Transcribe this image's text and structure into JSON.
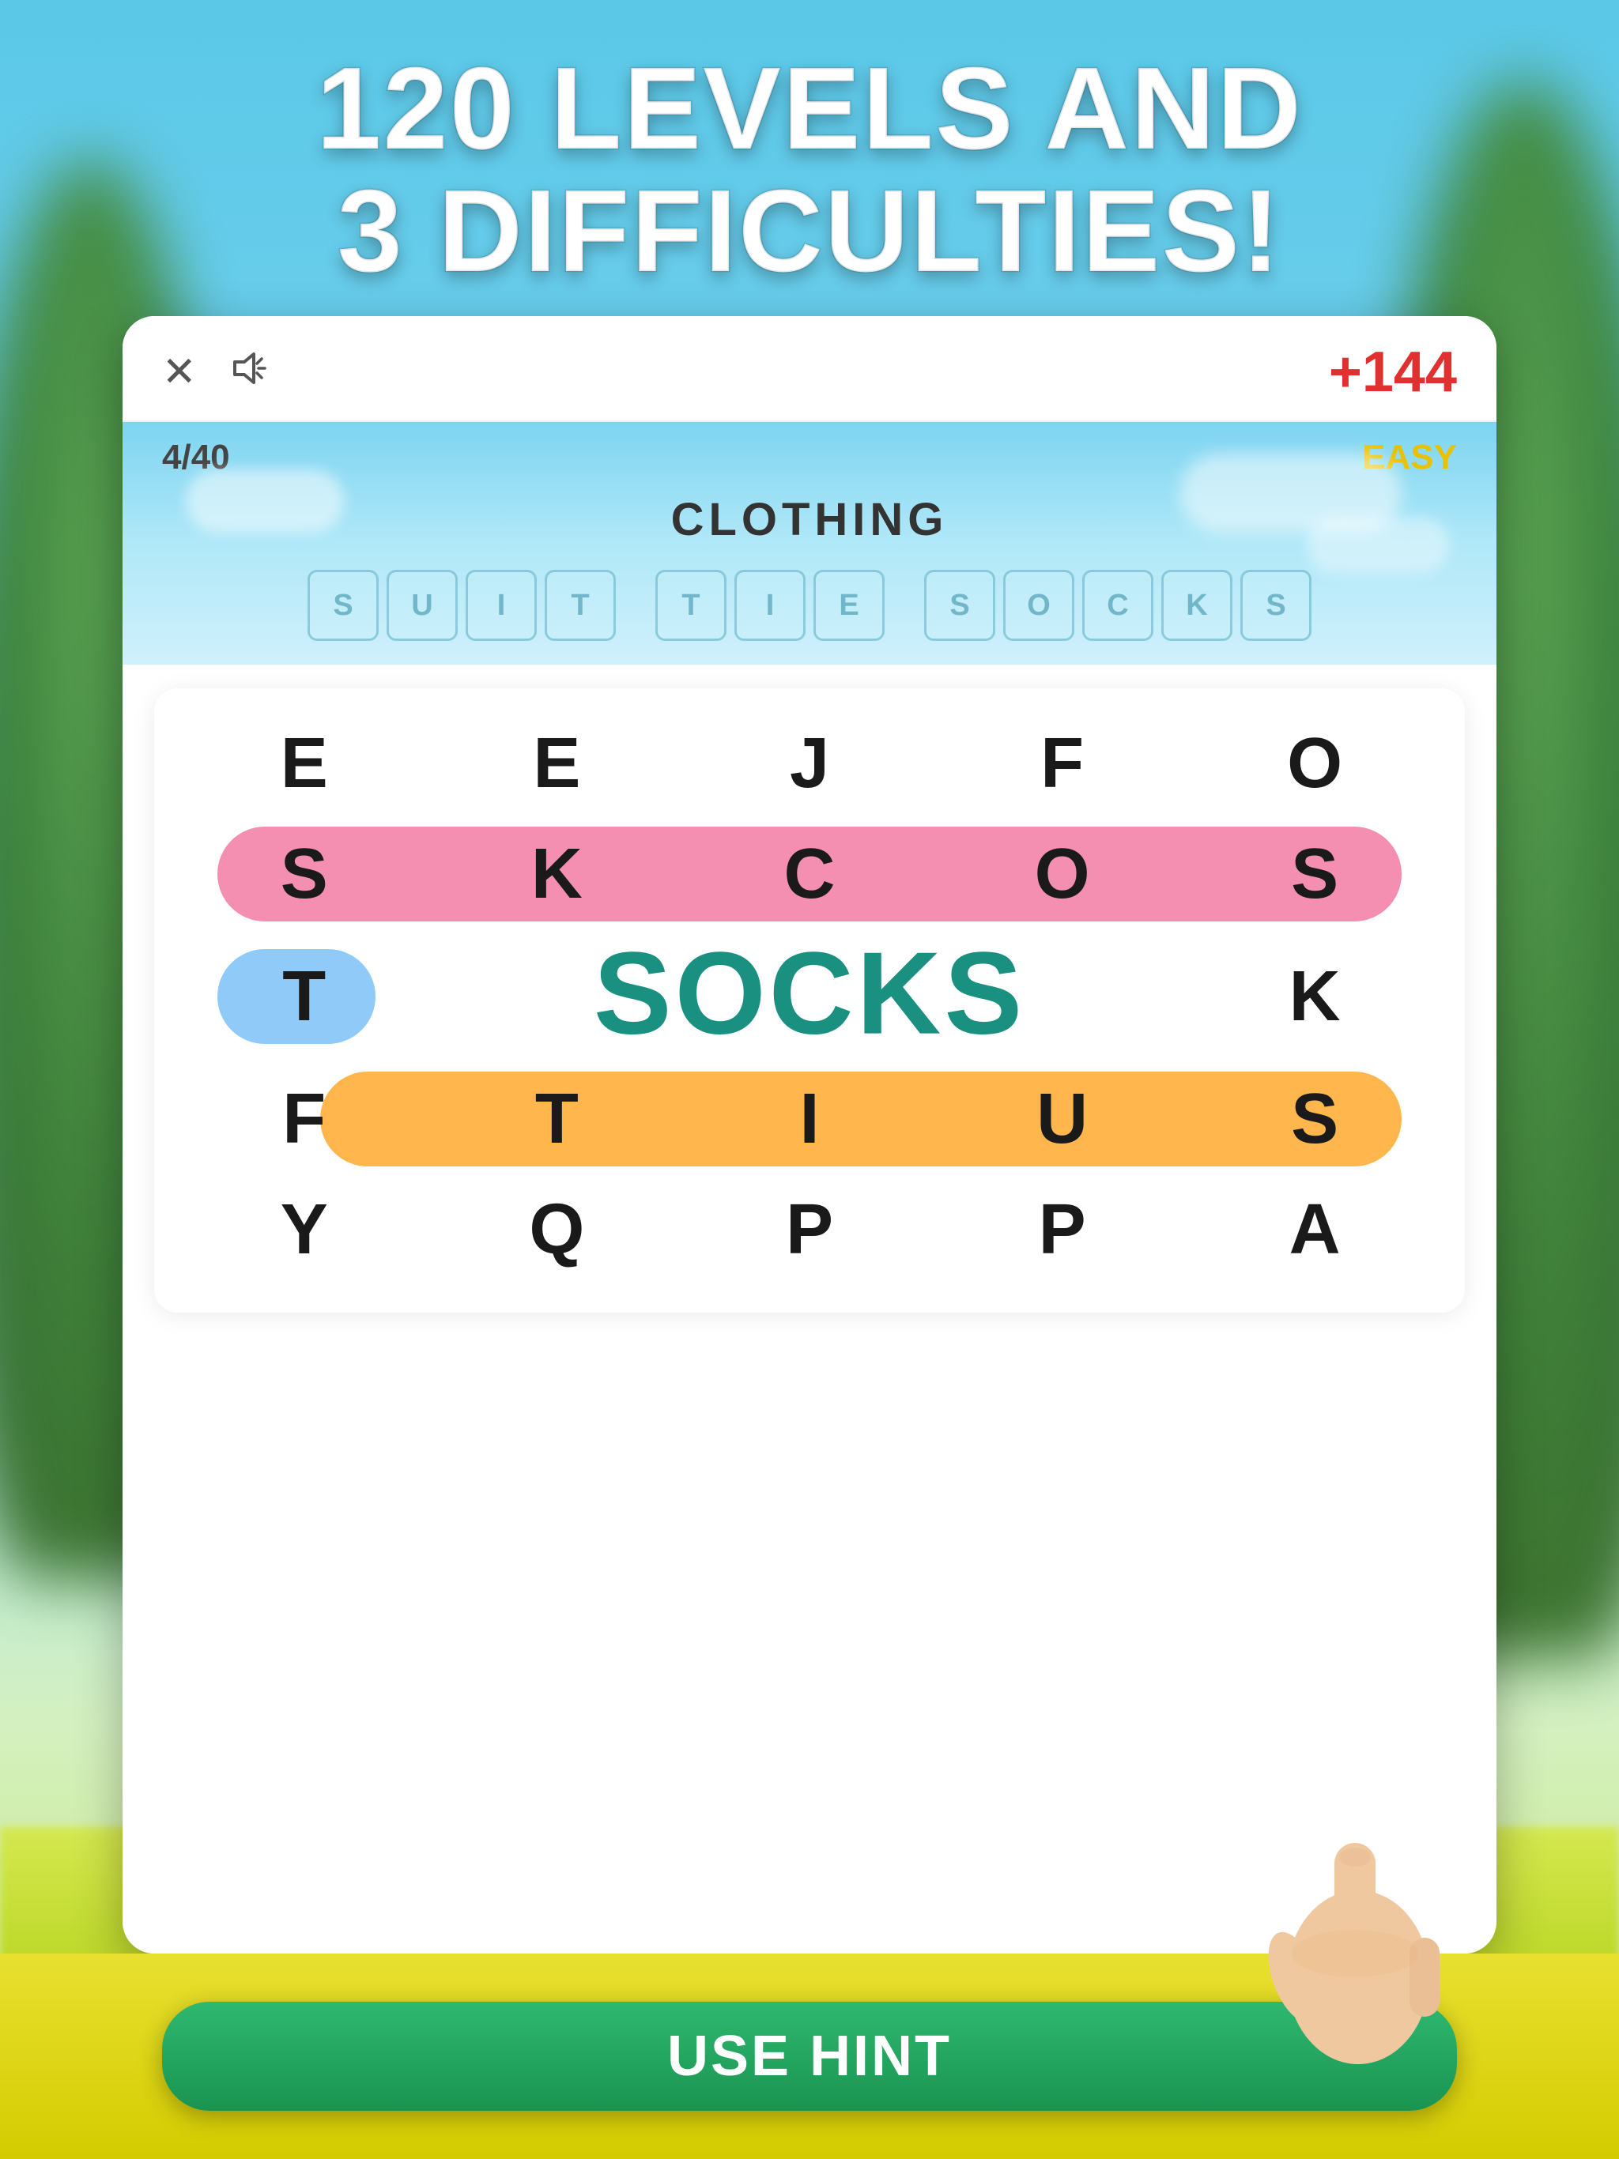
{
  "header": {
    "line1": "120 LEVELS AND",
    "line2": "3 DIFFICULTIES!"
  },
  "topbar": {
    "close_icon": "✕",
    "sound_icon": "🔔",
    "score": "+144"
  },
  "game": {
    "level": "4/40",
    "difficulty": "EASY",
    "category": "CLOTHING",
    "answer_tiles": [
      "S",
      "U",
      "I",
      "T",
      "",
      "T",
      "I",
      "E",
      "",
      "S",
      "O",
      "C",
      "K",
      "S"
    ],
    "found_word": "SOCKS",
    "grid": [
      [
        "E",
        "E",
        "J",
        "F",
        "O"
      ],
      [
        "S",
        "K",
        "C",
        "O",
        "S"
      ],
      [
        "T",
        "",
        "",
        "",
        "K"
      ],
      [
        "F",
        "T",
        "I",
        "U",
        "S"
      ],
      [
        "Y",
        "Q",
        "P",
        "P",
        "A"
      ]
    ]
  },
  "hint_button": {
    "label": "USE HINT"
  }
}
